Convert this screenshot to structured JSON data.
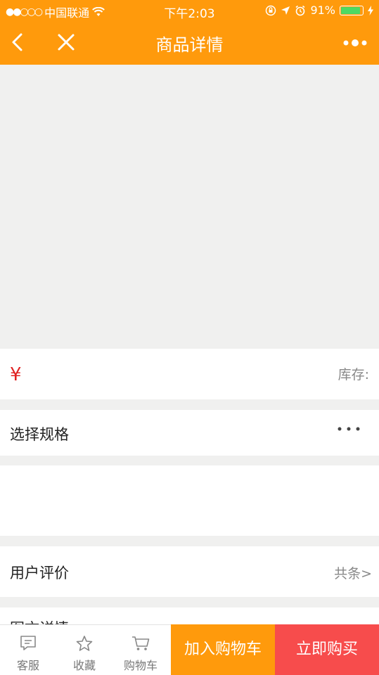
{
  "status_bar": {
    "signal": "●●○○○",
    "carrier": "中国联通",
    "time": "下午2:03",
    "battery_percent": "91%",
    "battery_level": 0.91
  },
  "nav": {
    "title": "商品详情"
  },
  "price": {
    "currency_symbol": "¥",
    "stock_label": "库存:"
  },
  "spec": {
    "label": "选择规格"
  },
  "review": {
    "label": "用户评价",
    "count_text": "共条>"
  },
  "detail": {
    "label": "图文详情"
  },
  "bottom_bar": {
    "service": "客服",
    "favorite": "收藏",
    "cart": "购物车",
    "add_to_cart": "加入购物车",
    "buy_now": "立即购买"
  },
  "colors": {
    "brand": "#ff9a0c",
    "buy": "#f74c4c",
    "price": "#e02020"
  }
}
